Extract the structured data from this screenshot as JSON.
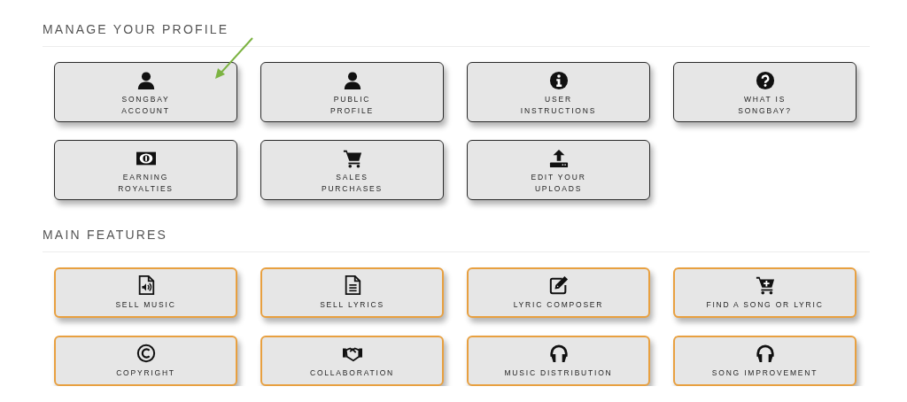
{
  "sections": [
    {
      "title": "MANAGE YOUR PROFILE",
      "kind": "profile",
      "items": [
        {
          "kind": "user",
          "lines": [
            "SONGBAY",
            "ACCOUNT"
          ],
          "pointed": true
        },
        {
          "kind": "user",
          "lines": [
            "PUBLIC",
            "PROFILE"
          ],
          "pointed": false
        },
        {
          "kind": "info",
          "lines": [
            "USER",
            "INSTRUCTIONS"
          ],
          "pointed": false
        },
        {
          "kind": "question",
          "lines": [
            "WHAT IS",
            "SONGBAY?"
          ],
          "pointed": false
        },
        {
          "kind": "money",
          "lines": [
            "EARNING",
            "ROYALTIES"
          ],
          "pointed": false
        },
        {
          "kind": "cart",
          "lines": [
            "SALES",
            "PURCHASES"
          ],
          "pointed": false
        },
        {
          "kind": "upload",
          "lines": [
            "EDIT YOUR",
            "UPLOADS"
          ],
          "pointed": false
        }
      ]
    },
    {
      "title": "MAIN FEATURES",
      "kind": "feature",
      "items": [
        {
          "kind": "audio-file",
          "lines": [
            "SELL MUSIC"
          ],
          "pointed": false
        },
        {
          "kind": "text-file",
          "lines": [
            "SELL LYRICS"
          ],
          "pointed": false
        },
        {
          "kind": "edit",
          "lines": [
            "LYRIC COMPOSER"
          ],
          "pointed": false
        },
        {
          "kind": "cart-plus",
          "lines": [
            "FIND A SONG OR LYRIC"
          ],
          "pointed": false
        },
        {
          "kind": "copyright",
          "lines": [
            "COPYRIGHT"
          ],
          "pointed": false
        },
        {
          "kind": "handshake",
          "lines": [
            "COLLABORATION"
          ],
          "pointed": false
        },
        {
          "kind": "headphones",
          "lines": [
            "MUSIC DISTRIBUTION"
          ],
          "pointed": false
        },
        {
          "kind": "headphones",
          "lines": [
            "SONG IMPROVEMENT"
          ],
          "pointed": false
        }
      ]
    }
  ]
}
